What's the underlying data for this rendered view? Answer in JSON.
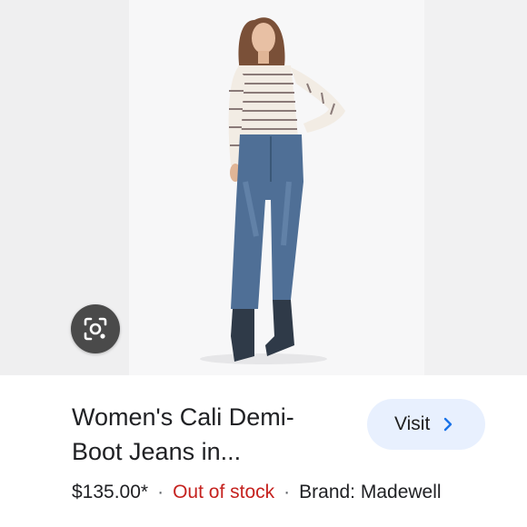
{
  "product": {
    "title_line1": "Women's Cali Demi-",
    "title_line2": "Boot Jeans in...",
    "price": "$135.00*",
    "stock_status": "Out of stock",
    "brand": "Brand: Madewell",
    "visit_label": "Visit"
  },
  "icons": {
    "lens": "camera-search-icon",
    "chevron": "chevron-right-icon"
  },
  "colors": {
    "out_of_stock": "#c5221f",
    "visit_bg": "#e8f0fe",
    "chevron": "#1a73e8"
  }
}
